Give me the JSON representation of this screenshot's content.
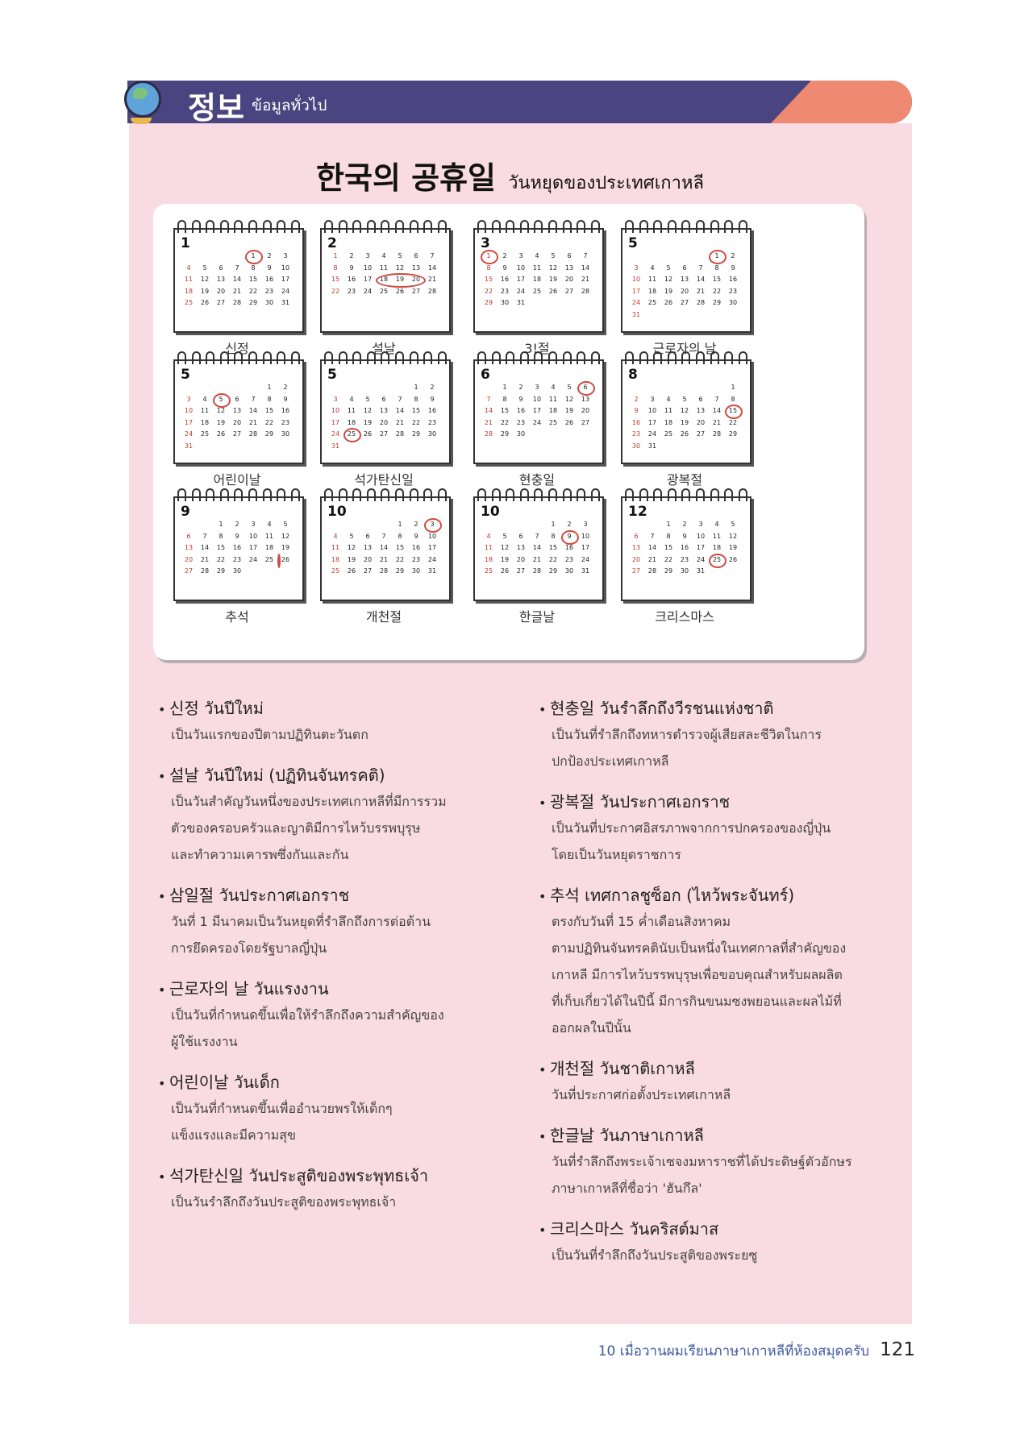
{
  "header": {
    "korean": "정보",
    "thai": "ข้อมูลทั่วไป"
  },
  "title": {
    "korean": "한국의 공휴일",
    "thai": "วันหยุดของประเทศเกาหลี"
  },
  "calendars": [
    {
      "month": "1",
      "label": "신정",
      "start": 4,
      "days": 31,
      "mark": "1",
      "circles": [
        1
      ]
    },
    {
      "month": "2",
      "label": "설날",
      "start": 0,
      "days": 28,
      "mark": "18-20",
      "circles": [
        18,
        19,
        20
      ]
    },
    {
      "month": "3",
      "label": "3!절",
      "start": 0,
      "days": 31,
      "mark": "1",
      "circles": [
        1
      ]
    },
    {
      "month": "5",
      "label": "근로자의 날",
      "start": 5,
      "days": 31,
      "mark": "1",
      "circles": [
        1
      ]
    },
    {
      "month": "5",
      "label": "어린이날",
      "start": 5,
      "days": 31,
      "mark": "5",
      "circles": [
        5
      ]
    },
    {
      "month": "5",
      "label": "석가탄신일",
      "start": 5,
      "days": 31,
      "mark": "25",
      "circles": [
        25
      ]
    },
    {
      "month": "6",
      "label": "현충일",
      "start": 1,
      "days": 30,
      "mark": "6",
      "circles": [
        6
      ]
    },
    {
      "month": "8",
      "label": "광복절",
      "start": 6,
      "days": 31,
      "mark": "15",
      "circles": [
        15
      ]
    },
    {
      "month": "9",
      "label": "추석",
      "start": 2,
      "days": 30,
      "mark": "26-28",
      "circles": [
        26,
        27,
        28
      ]
    },
    {
      "month": "10",
      "label": "개천절",
      "start": 4,
      "days": 31,
      "mark": "3",
      "circles": [
        3
      ]
    },
    {
      "month": "10",
      "label": "한글날",
      "start": 4,
      "days": 31,
      "mark": "9",
      "circles": [
        9
      ]
    },
    {
      "month": "12",
      "label": "크리스마스",
      "start": 2,
      "days": 31,
      "mark": "25",
      "circles": [
        25
      ]
    }
  ],
  "left_entries": [
    {
      "term": "신정",
      "meaning": "วันปีใหม่",
      "lines": [
        "เป็นวันแรกของปีตามปฏิทินตะวันตก"
      ]
    },
    {
      "term": "설날",
      "meaning": "วันปีใหม่ (ปฏิทินจันทรคติ)",
      "lines": [
        "เป็นวันสำคัญวันหนึ่งของประเทศเกาหลีที่มีการรวม",
        "ตัวของครอบครัวและญาติมีการไหว้บรรพบุรุษ",
        "และทำความเคารพซึ่งกันและกัน"
      ]
    },
    {
      "term": "삼일절",
      "meaning": "วันประกาศเอกราช",
      "lines": [
        "วันที่ 1 มีนาคมเป็นวันหยุดที่รำลึกถึงการต่อต้าน",
        "การยึดครองโดยรัฐบาลญี่ปุ่น"
      ]
    },
    {
      "term": "근로자의 날",
      "meaning": "วันแรงงาน",
      "lines": [
        "เป็นวันที่กำหนดขึ้นเพื่อให้รำลึกถึงความสำคัญของ",
        "ผู้ใช้แรงงาน"
      ]
    },
    {
      "term": "어린이날",
      "meaning": "วันเด็ก",
      "lines": [
        "เป็นวันที่กำหนดขึ้นเพื่ออำนวยพรให้เด็กๆ",
        "แข็งแรงและมีความสุข"
      ]
    },
    {
      "term": "석가탄신일",
      "meaning": "วันประสูติของพระพุทธเจ้า",
      "lines": [
        "เป็นวันรำลึกถึงวันประสูติของพระพุทธเจ้า"
      ]
    }
  ],
  "right_entries": [
    {
      "term": "현충일",
      "meaning": "วันรำลึกถึงวีรชนแห่งชาติ",
      "lines": [
        "เป็นวันที่รำลึกถึงทหารตำรวจผู้เสียสละชีวิตในการ",
        "ปกป้องประเทศเกาหลี"
      ]
    },
    {
      "term": "광복절",
      "meaning": "วันประกาศเอกราช",
      "lines": [
        "เป็นวันที่ประกาศอิสรภาพจากการปกครองของญี่ปุ่น",
        "โดยเป็นวันหยุดราชการ"
      ]
    },
    {
      "term": "추석",
      "meaning": "เทศกาลชูซ็อก (ไหว้พระจันทร์)",
      "lines": [
        "ตรงกับวันที่ 15 ค่ำเดือนสิงหาคม",
        "ตามปฏิทินจันทรคตินับเป็นหนึ่งในเทศกาลที่สำคัญของ",
        "เกาหลี มีการไหว้บรรพบุรุษเพื่อขอบคุณสำหรับผลผลิต",
        "ที่เก็บเกี่ยวได้ในปีนี้ มีการกินขนมซงพยอนและผลไม้ที่",
        "ออกผลในปีนั้น"
      ]
    },
    {
      "term": "개천절",
      "meaning": "วันชาติเกาหลี",
      "lines": [
        "วันที่ประกาศก่อตั้งประเทศเกาหลี"
      ]
    },
    {
      "term": "한글날",
      "meaning": "วันภาษาเกาหลี",
      "lines": [
        "วันที่รำลึกถึงพระเจ้าเซจงมหาราชที่ได้ประดิษฐ์ตัวอักษร",
        "ภาษาเกาหลีที่ชื่อว่า 'ฮันกึล'"
      ]
    },
    {
      "term": "크리스마스",
      "meaning": "วันคริสต์มาส",
      "lines": [
        "เป็นวันที่รำลึกถึงวันประสูติของพระยซู"
      ]
    }
  ],
  "footer": {
    "text": "10 เมื่อวานผมเรียนภาษาเกาหลีที่ห้องสมุดครับ",
    "page": "121"
  },
  "colors": {
    "header": "#4a4580",
    "accent": "#ef8a72",
    "panel": "#f9dbe4",
    "mark": "#d04a3f"
  }
}
